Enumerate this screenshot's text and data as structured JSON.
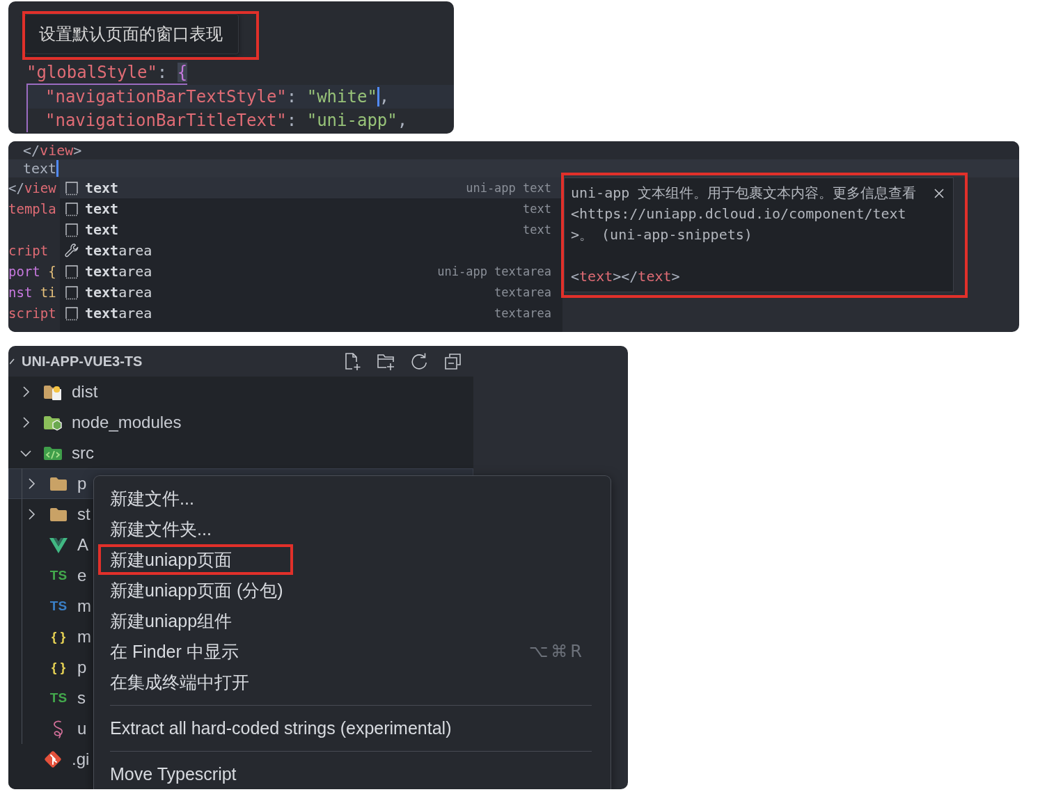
{
  "settings_snippet": {
    "tooltip": {
      "text": "设置默认页面的窗口表现",
      "annotated": true
    },
    "lines": [
      {
        "current": false,
        "tokens": [
          {
            "text": "\"globalStyle\"",
            "kind": "key"
          },
          {
            "text": ": ",
            "kind": "punct"
          },
          {
            "text": "{",
            "kind": "bracket"
          }
        ],
        "children": [
          {
            "current": true,
            "tokens": [
              {
                "text": "\"navigationBarTextStyle\"",
                "kind": "key"
              },
              {
                "text": ": ",
                "kind": "punct"
              },
              {
                "text": "\"white\"",
                "kind": "string",
                "cursor": true
              },
              {
                "text": ",",
                "kind": "punct"
              }
            ]
          },
          {
            "current": false,
            "tokens": [
              {
                "text": "\"navigationBarTitleText\"",
                "kind": "key"
              },
              {
                "text": ": ",
                "kind": "punct"
              },
              {
                "text": "\"uni-app\"",
                "kind": "string"
              },
              {
                "text": ",",
                "kind": "punct"
              }
            ]
          }
        ]
      }
    ]
  },
  "completion_snippet": {
    "lines": [
      {
        "current": false,
        "tokens": [
          {
            "text": "</",
            "kind": "punct"
          },
          {
            "text": "view",
            "kind": "tag"
          },
          {
            "text": ">",
            "kind": "punct"
          }
        ]
      },
      {
        "current": true,
        "tokens": [
          {
            "text": "text",
            "kind": "plain",
            "cursor": true
          }
        ]
      }
    ],
    "covered_lines": [
      {
        "kind": "code",
        "tokens": [
          {
            "text": "</",
            "kind": "punct"
          },
          {
            "text": "view",
            "kind": "tag"
          }
        ]
      },
      {
        "kind": "code",
        "tokens": [
          {
            "text": "templa",
            "kind": "tag"
          }
        ]
      },
      {
        "kind": "blank"
      },
      {
        "kind": "code",
        "tokens": [
          {
            "text": "cript",
            "kind": "tag"
          }
        ]
      },
      {
        "kind": "code",
        "tokens": [
          {
            "text": "port",
            "kind": "keyword"
          },
          {
            "text": " {",
            "kind": "brace"
          }
        ]
      },
      {
        "kind": "code",
        "tokens": [
          {
            "text": "nst",
            "kind": "keyword"
          },
          {
            "text": " ti",
            "kind": "variable"
          }
        ]
      },
      {
        "kind": "code",
        "tokens": [
          {
            "text": "script",
            "kind": "tag"
          }
        ]
      }
    ],
    "suggestions": [
      {
        "label": "text",
        "detail": "uni-app text",
        "kind": "snippet",
        "selected": true,
        "full_match": true
      },
      {
        "label": "text",
        "detail": "text",
        "kind": "snippet",
        "selected": false,
        "full_match": true
      },
      {
        "label": "text",
        "detail": "text",
        "kind": "snippet",
        "selected": false,
        "full_match": true
      },
      {
        "label": "**text**area",
        "kind": "property",
        "selected": false,
        "full_match": false
      },
      {
        "label": "**text**area",
        "detail": "uni-app textarea",
        "kind": "snippet",
        "selected": false,
        "full_match": false
      },
      {
        "label": "**text**area",
        "detail": "textarea",
        "kind": "snippet",
        "selected": false,
        "full_match": false
      },
      {
        "label": "**text**area",
        "detail": "textarea",
        "kind": "snippet",
        "selected": false,
        "full_match": false
      }
    ],
    "details": {
      "description": "uni-app 文本组件。用于包裹文本内容。更多信息查看\n<https://uniapp.dcloud.io/component/text\n>。 (uni-app-snippets)",
      "code": [
        {
          "text": "<",
          "kind": "punct"
        },
        {
          "text": "text",
          "kind": "tag"
        },
        {
          "text": "></",
          "kind": "punct"
        },
        {
          "text": "text",
          "kind": "tag"
        },
        {
          "text": ">",
          "kind": "punct"
        }
      ],
      "annotated": true
    }
  },
  "explorer": {
    "title": "UNI-APP-VUE3-TS",
    "tree": [
      {
        "name": "dist",
        "kind": "dist",
        "expanded": false,
        "selected": false
      },
      {
        "name": "node_modules",
        "kind": "modules",
        "expanded": false,
        "selected": false
      },
      {
        "name": "src",
        "kind": "source",
        "expanded": true,
        "selected": false,
        "children": [
          {
            "name": "p",
            "kind": "folder",
            "expanded": false,
            "selected": true
          },
          {
            "name": "st",
            "kind": "folder",
            "expanded": false,
            "selected": false
          },
          {
            "name": "A",
            "kind": "vue",
            "selected": false
          },
          {
            "name": "e",
            "kind": "badge",
            "badge": "TS",
            "color": "#43a84c",
            "selected": false
          },
          {
            "name": "m",
            "kind": "badge",
            "badge": "TS",
            "color": "#3a7fc6",
            "selected": false
          },
          {
            "name": "m",
            "kind": "badge",
            "badge": "{ }",
            "color": "#e3cf53",
            "selected": false
          },
          {
            "name": "p",
            "kind": "badge",
            "badge": "{ }",
            "color": "#e3cf53",
            "selected": false
          },
          {
            "name": "s",
            "kind": "badge",
            "badge": "TS",
            "color": "#43a84c",
            "selected": false
          },
          {
            "name": "u",
            "kind": "uni",
            "selected": false
          }
        ]
      },
      {
        "name": ".gi",
        "kind": "git",
        "selected": false
      }
    ]
  },
  "context_menu": {
    "items": [
      {
        "kind": "item",
        "label": "新建文件...",
        "annotated": false
      },
      {
        "kind": "item",
        "label": "新建文件夹...",
        "annotated": false
      },
      {
        "kind": "item",
        "label": "新建uniapp页面",
        "annotated": true
      },
      {
        "kind": "item",
        "label": "新建uniapp页面 (分包)",
        "annotated": false
      },
      {
        "kind": "item",
        "label": "新建uniapp组件",
        "annotated": false
      },
      {
        "kind": "item",
        "label": "在 Finder 中显示",
        "shortcut": "⌥⌘R",
        "annotated": false
      },
      {
        "kind": "item",
        "label": "在集成终端中打开",
        "annotated": false
      },
      {
        "kind": "separator"
      },
      {
        "kind": "item",
        "label": "Extract all hard-coded strings (experimental)",
        "annotated": false
      },
      {
        "kind": "separator"
      },
      {
        "kind": "item",
        "label": "Move Typescript",
        "annotated": false
      }
    ]
  }
}
